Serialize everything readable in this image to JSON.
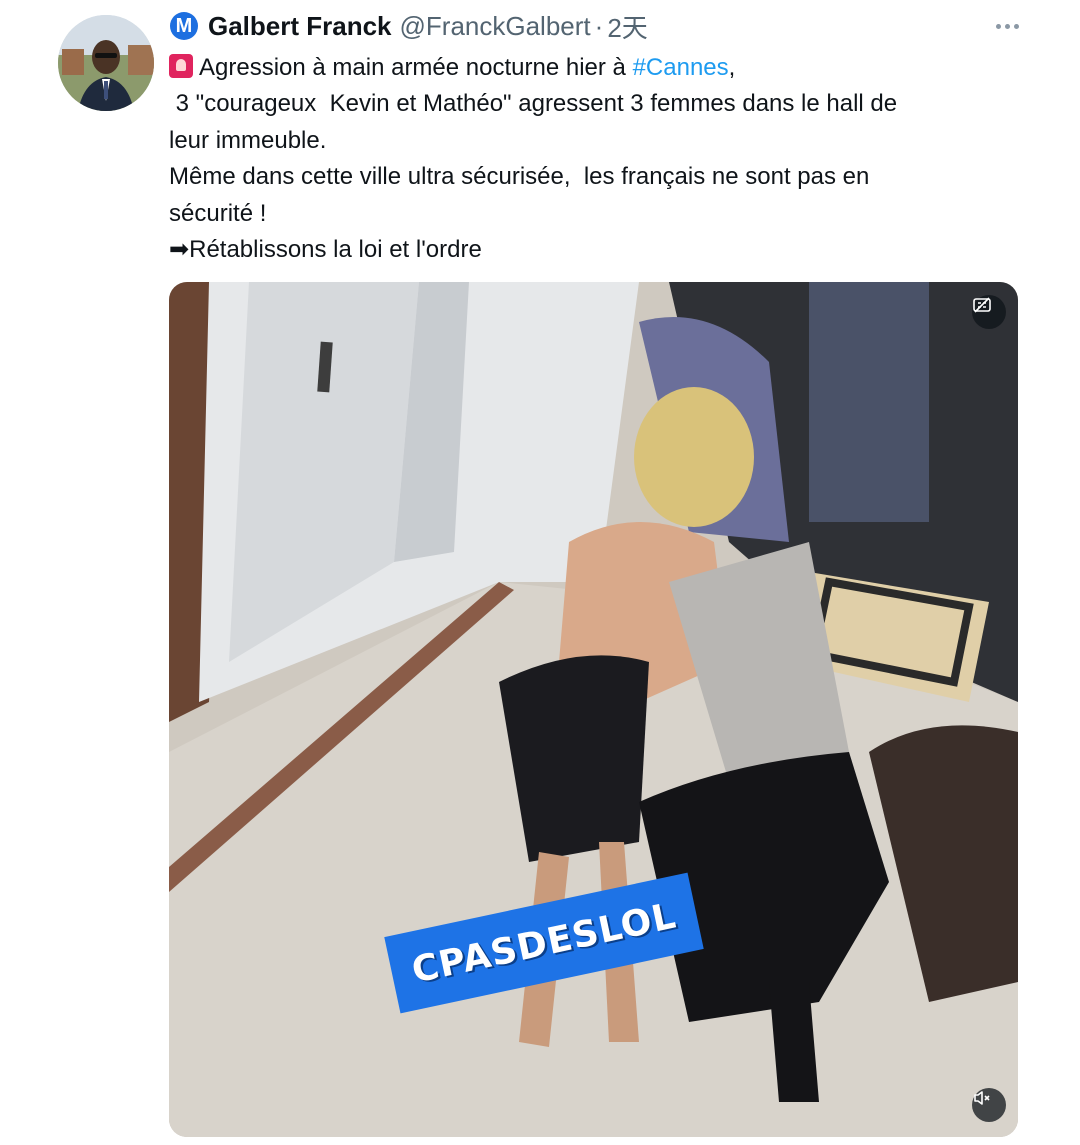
{
  "author": {
    "badge": "M",
    "name": "Galbert Franck",
    "handle": "@FranckGalbert",
    "separator": "·",
    "time": "2天"
  },
  "tweet": {
    "line1_before": "Agression à main armée nocturne hier à ",
    "line1_hashtag": "#Cannes",
    "line1_after": ",",
    "line2": " 3 \"courageux  Kevin et Mathéo\" agressent 3 femmes dans le hall de",
    "line3": "leur immeuble.",
    "line4": "Même dans cette ville ultra sécurisée,  les français ne sont pas en",
    "line5": "sécurité !",
    "line6": "➡Rétablissons la loi et l'ordre"
  },
  "media": {
    "watermark": "CPASDESLOL"
  },
  "icons": {
    "badge": "verified-m-badge",
    "siren": "siren-emoji-icon",
    "more": "more-options-icon",
    "captions": "captions-icon",
    "mute": "muted-speaker-icon"
  }
}
